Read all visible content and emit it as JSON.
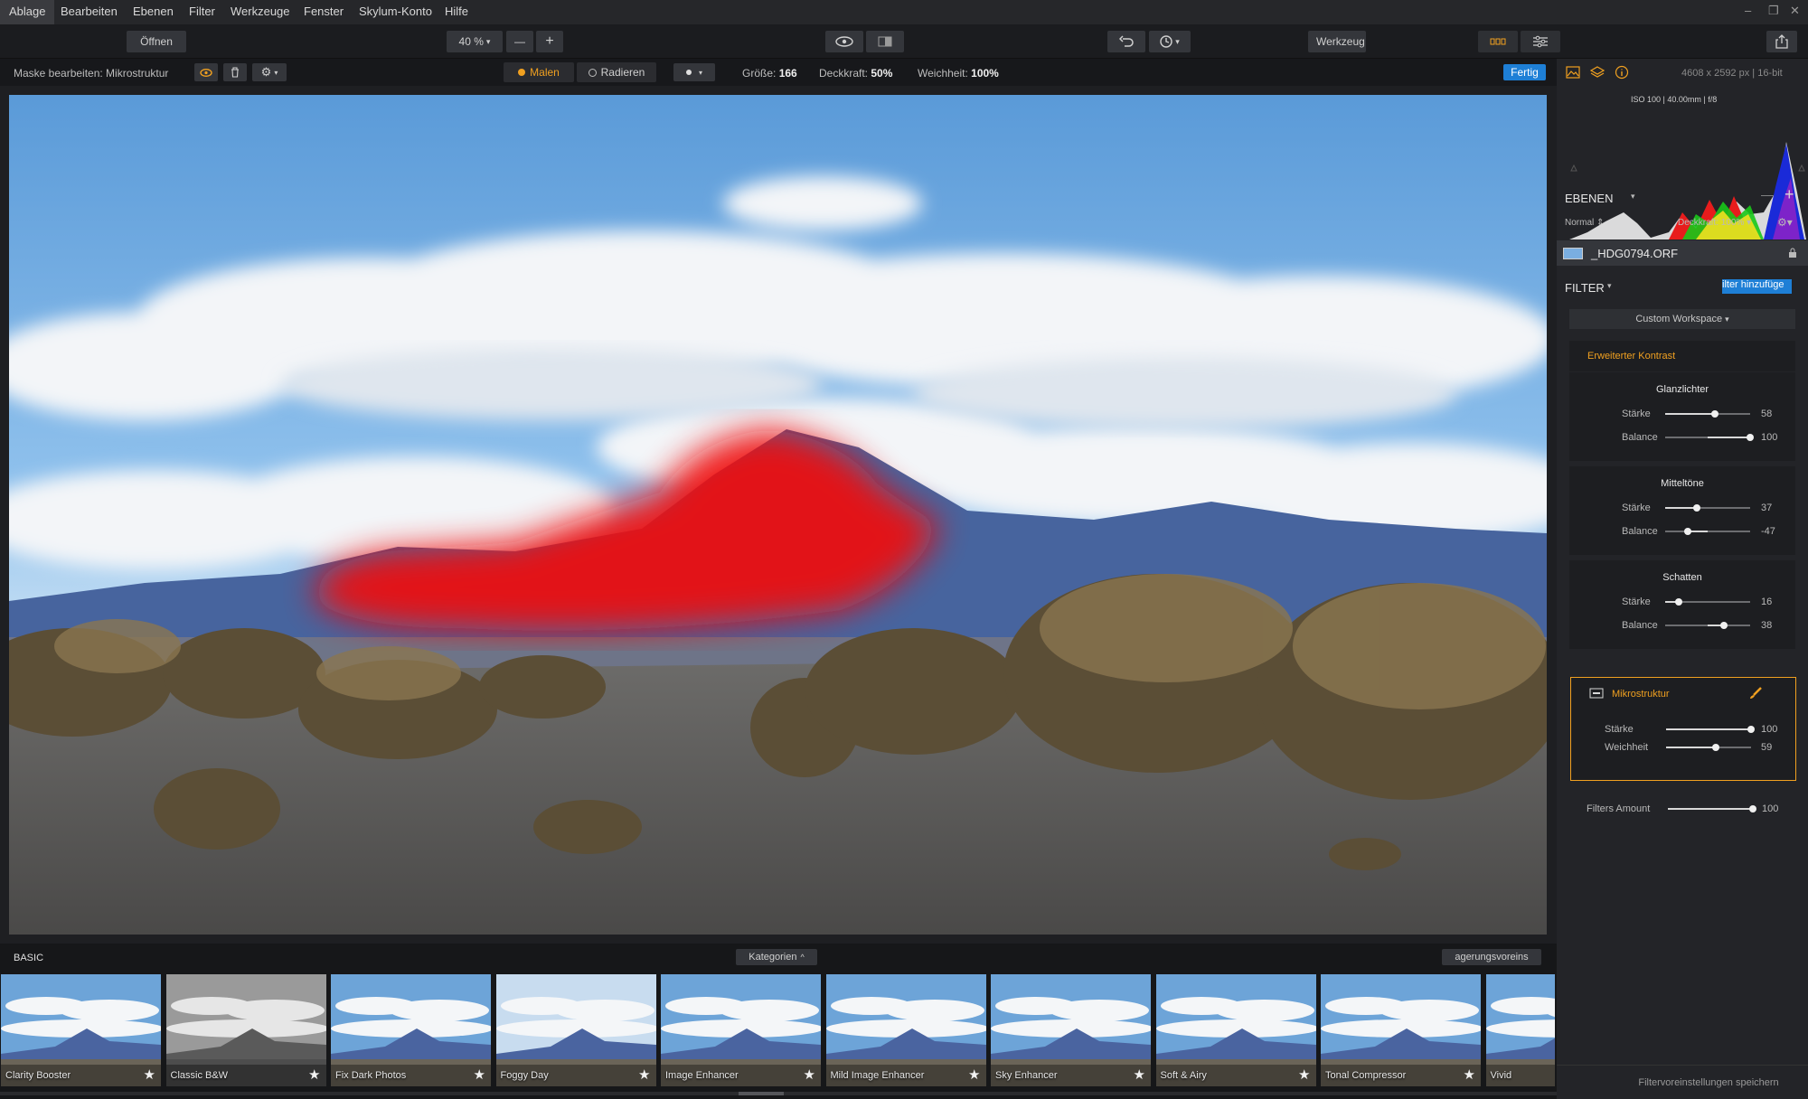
{
  "menu": [
    "Ablage",
    "Bearbeiten",
    "Ebenen",
    "Filter",
    "Werkzeuge",
    "Fenster",
    "Skylum-Konto",
    "Hilfe"
  ],
  "toolbar": {
    "open_label": "Öffnen",
    "zoom": "40 %",
    "zoom_minus": "—",
    "zoom_plus": "+",
    "tools_label": "Werkzeug"
  },
  "maskbar": {
    "title": "Maske bearbeiten: Mikrostruktur",
    "paint_label": "Malen",
    "erase_label": "Radieren",
    "size_label": "Größe:",
    "size_value": "166",
    "opacity_label": "Deckkraft:",
    "opacity_value": "50%",
    "softness_label": "Weichheit:",
    "softness_value": "100%",
    "done_label": "Fertig"
  },
  "panel": {
    "image_info": "4608 x 2592 px  |  16-bit",
    "exif": "ISO 100  |  40.00mm  |  f/8",
    "layers_title": "EBENEN",
    "blend_mode": "Normal",
    "layer_opacity": "Deckkraft: 100%",
    "layer_name": "_HDG0794.ORF",
    "filter_title": "FILTER",
    "add_filter_label": "ilter hinzufüge",
    "workspace": "Custom Workspace",
    "filter_group_title": "Erweiterter Kontrast",
    "sections": [
      {
        "title": "Glanzlichter",
        "sliders": [
          {
            "label": "Stärke",
            "value": 58
          },
          {
            "label": "Balance",
            "value": 100
          }
        ]
      },
      {
        "title": "Mitteltöne",
        "sliders": [
          {
            "label": "Stärke",
            "value": 37
          },
          {
            "label": "Balance",
            "value": -47
          }
        ]
      },
      {
        "title": "Schatten",
        "sliders": [
          {
            "label": "Stärke",
            "value": 16
          },
          {
            "label": "Balance",
            "value": 38
          }
        ]
      }
    ],
    "micro": {
      "title": "Mikrostruktur",
      "sliders": [
        {
          "label": "Stärke",
          "value": 100
        },
        {
          "label": "Weichheit",
          "value": 59
        }
      ]
    },
    "filters_amount_label": "Filters Amount",
    "filters_amount_value": 100,
    "save_presets_label": "Filtervoreinstellungen speichern"
  },
  "presets": {
    "category": "BASIC",
    "categories_label": "Kategorien",
    "presets_button": "agerungsvoreins",
    "items": [
      "Clarity Booster",
      "Classic B&W",
      "Fix Dark Photos",
      "Foggy Day",
      "Image Enhancer",
      "Mild Image Enhancer",
      "Sky Enhancer",
      "Soft & Airy",
      "Tonal Compressor",
      "Vivid"
    ]
  },
  "colors": {
    "accent_orange": "#f0a020",
    "accent_blue": "#1e7fd6",
    "mask_red": "#f01010"
  }
}
